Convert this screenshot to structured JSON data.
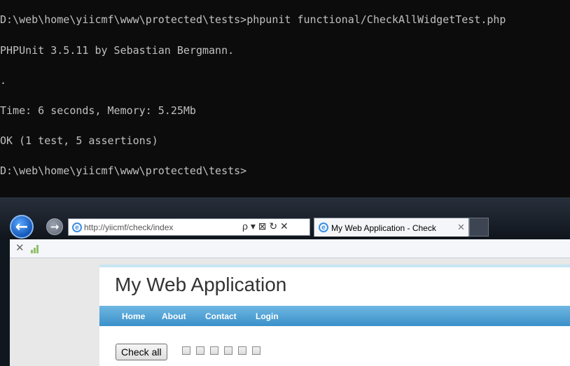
{
  "console": {
    "lines": [
      "D:\\web\\home\\yiicmf\\www\\protected\\tests>phpunit functional/CheckAllWidgetTest.php",
      "PHPUnit 3.5.11 by Sebastian Bergmann.",
      ".",
      "Time: 6 seconds, Memory: 5.25Mb",
      "OK (1 test, 5 assertions)",
      "D:\\web\\home\\yiicmf\\www\\protected\\tests>"
    ]
  },
  "browser": {
    "address": "http://yiicmf/check/index",
    "address_tools": "ρ ▾ ⊠ ↻ ✕",
    "tab_title": "My Web Application - Check",
    "tab_close": "✕",
    "stop_glyph": "✕",
    "page": {
      "title": "My Web Application",
      "menu": [
        "Home",
        "About",
        "Contact",
        "Login"
      ],
      "check_all_label": "Check all",
      "checkbox_count": 6
    }
  },
  "colors": {
    "console_bg": "#0c0c0c",
    "console_text": "#c0c0c0",
    "menu_bar": "#4a9fd5",
    "frame": "#1c222b"
  }
}
